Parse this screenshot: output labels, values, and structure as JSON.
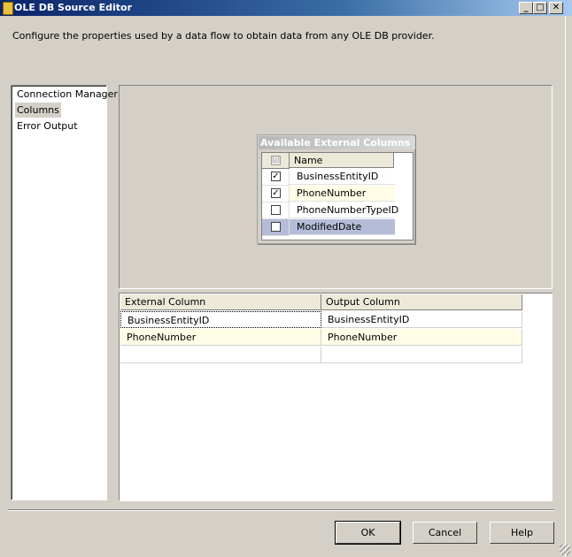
{
  "window": {
    "title": "OLE DB Source Editor",
    "minimize_glyph": "_",
    "maximize_glyph": "□",
    "close_glyph": "✕"
  },
  "description": "Configure the properties used by a data flow to obtain data from any OLE DB provider.",
  "nav": {
    "items": [
      {
        "label": "Connection Manager",
        "selected": false
      },
      {
        "label": "Columns",
        "selected": true
      },
      {
        "label": "Error Output",
        "selected": false
      }
    ]
  },
  "available_columns": {
    "title": "Available External Columns",
    "header_check": "☑",
    "name_header": "Name",
    "rows": [
      {
        "name": "BusinessEntityID",
        "checked": true,
        "check_glyph": "✓"
      },
      {
        "name": "PhoneNumber",
        "checked": true,
        "check_glyph": "✓"
      },
      {
        "name": "PhoneNumberTypeID",
        "checked": false,
        "check_glyph": ""
      },
      {
        "name": "ModifiedDate",
        "checked": false,
        "check_glyph": ""
      }
    ]
  },
  "mapping": {
    "headers": [
      "External Column",
      "Output Column"
    ],
    "rows": [
      [
        "BusinessEntityID",
        "BusinessEntityID"
      ],
      [
        "PhoneNumber",
        "PhoneNumber"
      ],
      [
        "",
        ""
      ]
    ]
  },
  "buttons": {
    "ok": "OK",
    "cancel": "Cancel",
    "help": "Help"
  }
}
